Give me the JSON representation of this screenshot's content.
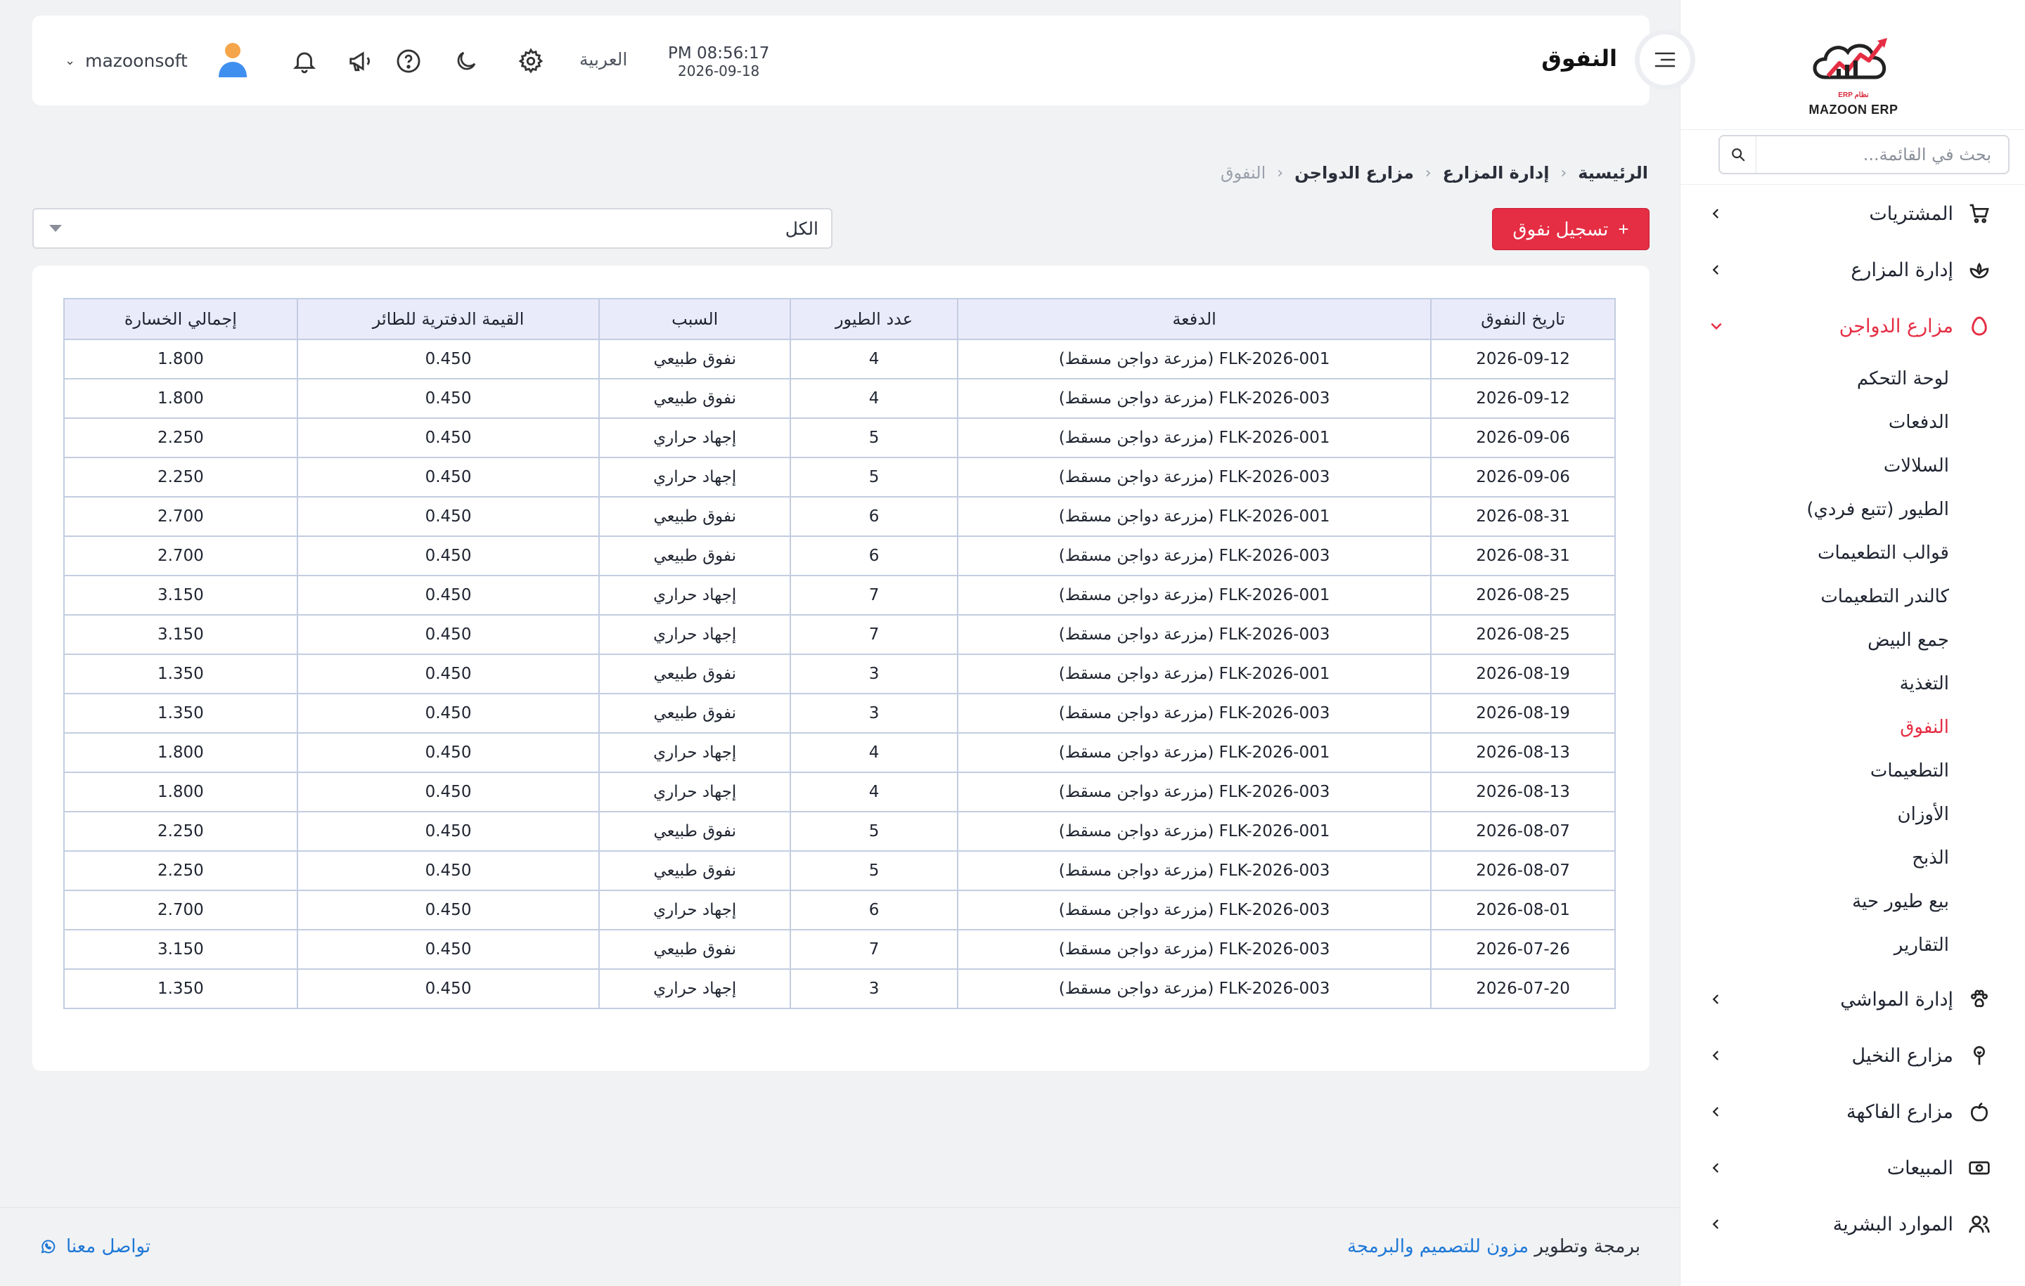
{
  "brand": {
    "logo_text": "MAZOON ERP",
    "logo_sub": "ERP نظام"
  },
  "sidebar": {
    "search_placeholder": "بحث في القائمة...",
    "items": [
      {
        "label": "المشتريات",
        "icon": "cart-icon",
        "expanded": false
      },
      {
        "label": "إدارة المزارع",
        "icon": "sprout-icon",
        "expanded": false
      },
      {
        "label": "مزارع الدواجن",
        "icon": "egg-icon",
        "expanded": true,
        "active": true,
        "children": [
          {
            "label": "لوحة التحكم"
          },
          {
            "label": "الدفعات"
          },
          {
            "label": "السلالات"
          },
          {
            "label": "الطيور (تتبع فردي)"
          },
          {
            "label": "قوالب التطعيمات"
          },
          {
            "label": "كالندر التطعيمات"
          },
          {
            "label": "جمع البيض"
          },
          {
            "label": "التغذية"
          },
          {
            "label": "النفوق",
            "active": true
          },
          {
            "label": "التطعيمات"
          },
          {
            "label": "الأوزان"
          },
          {
            "label": "الذبح"
          },
          {
            "label": "بيع طيور حية"
          },
          {
            "label": "التقارير"
          }
        ]
      },
      {
        "label": "إدارة المواشي",
        "icon": "paw-icon",
        "expanded": false
      },
      {
        "label": "مزارع النخيل",
        "icon": "palm-icon",
        "expanded": false
      },
      {
        "label": "مزارع الفاكهة",
        "icon": "apple-icon",
        "expanded": false
      },
      {
        "label": "المبيعات",
        "icon": "cash-icon",
        "expanded": false
      },
      {
        "label": "الموارد البشرية",
        "icon": "users-icon",
        "expanded": false
      }
    ]
  },
  "header": {
    "title": "النفوق",
    "time": "PM 08:56:17",
    "date": "2026-09-18",
    "language": "العربية",
    "username": "mazoonsoft"
  },
  "breadcrumb": [
    "الرئيسية",
    "إدارة المزارع",
    "مزارع الدواجن",
    "النفوق"
  ],
  "actions": {
    "add_label": "تسجيل نفوق",
    "filter_value": "الكل"
  },
  "table": {
    "columns": [
      "تاريخ النفوق",
      "الدفعة",
      "عدد الطيور",
      "السبب",
      "القيمة الدفترية للطائر",
      "إجمالي الخسارة"
    ],
    "rows": [
      [
        "2026-09-12",
        "FLK-2026-001 (مزرعة دواجن مسقط)",
        "4",
        "نفوق طبيعي",
        "0.450",
        "1.800"
      ],
      [
        "2026-09-12",
        "FLK-2026-003 (مزرعة دواجن مسقط)",
        "4",
        "نفوق طبيعي",
        "0.450",
        "1.800"
      ],
      [
        "2026-09-06",
        "FLK-2026-001 (مزرعة دواجن مسقط)",
        "5",
        "إجهاد حراري",
        "0.450",
        "2.250"
      ],
      [
        "2026-09-06",
        "FLK-2026-003 (مزرعة دواجن مسقط)",
        "5",
        "إجهاد حراري",
        "0.450",
        "2.250"
      ],
      [
        "2026-08-31",
        "FLK-2026-001 (مزرعة دواجن مسقط)",
        "6",
        "نفوق طبيعي",
        "0.450",
        "2.700"
      ],
      [
        "2026-08-31",
        "FLK-2026-003 (مزرعة دواجن مسقط)",
        "6",
        "نفوق طبيعي",
        "0.450",
        "2.700"
      ],
      [
        "2026-08-25",
        "FLK-2026-001 (مزرعة دواجن مسقط)",
        "7",
        "إجهاد حراري",
        "0.450",
        "3.150"
      ],
      [
        "2026-08-25",
        "FLK-2026-003 (مزرعة دواجن مسقط)",
        "7",
        "إجهاد حراري",
        "0.450",
        "3.150"
      ],
      [
        "2026-08-19",
        "FLK-2026-001 (مزرعة دواجن مسقط)",
        "3",
        "نفوق طبيعي",
        "0.450",
        "1.350"
      ],
      [
        "2026-08-19",
        "FLK-2026-003 (مزرعة دواجن مسقط)",
        "3",
        "نفوق طبيعي",
        "0.450",
        "1.350"
      ],
      [
        "2026-08-13",
        "FLK-2026-001 (مزرعة دواجن مسقط)",
        "4",
        "إجهاد حراري",
        "0.450",
        "1.800"
      ],
      [
        "2026-08-13",
        "FLK-2026-003 (مزرعة دواجن مسقط)",
        "4",
        "إجهاد حراري",
        "0.450",
        "1.800"
      ],
      [
        "2026-08-07",
        "FLK-2026-001 (مزرعة دواجن مسقط)",
        "5",
        "نفوق طبيعي",
        "0.450",
        "2.250"
      ],
      [
        "2026-08-07",
        "FLK-2026-003 (مزرعة دواجن مسقط)",
        "5",
        "نفوق طبيعي",
        "0.450",
        "2.250"
      ],
      [
        "2026-08-01",
        "FLK-2026-003 (مزرعة دواجن مسقط)",
        "6",
        "إجهاد حراري",
        "0.450",
        "2.700"
      ],
      [
        "2026-07-26",
        "FLK-2026-003 (مزرعة دواجن مسقط)",
        "7",
        "نفوق طبيعي",
        "0.450",
        "3.150"
      ],
      [
        "2026-07-20",
        "FLK-2026-003 (مزرعة دواجن مسقط)",
        "3",
        "إجهاد حراري",
        "0.450",
        "1.350"
      ]
    ]
  },
  "footer": {
    "credits_prefix": "برمجة وتطوير",
    "credits_link": "مزون للتصميم والبرمجة",
    "contact": "تواصل معنا"
  },
  "colors": {
    "accent": "#e52d43",
    "link": "#1e78d6",
    "table_header": "#eaebfa"
  }
}
